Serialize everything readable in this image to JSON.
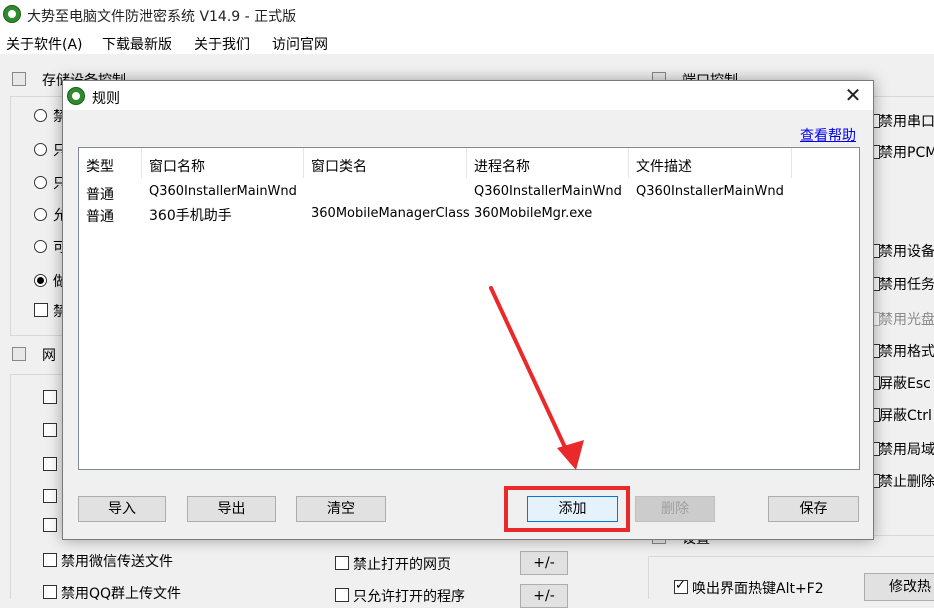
{
  "app": {
    "title": "大势至电脑文件防泄密系统 V14.9 - 正式版",
    "menu": [
      "关于软件(A)",
      "下载最新版",
      "关于我们",
      "访问官网"
    ]
  },
  "background": {
    "storage_group_title": "存储设备控制",
    "storage_options": [
      {
        "label": "禁",
        "type": "radio",
        "checked": false
      },
      {
        "label": "只",
        "type": "radio",
        "checked": false
      },
      {
        "label": "只",
        "type": "radio",
        "checked": false
      },
      {
        "label": "允",
        "type": "radio",
        "checked": false
      },
      {
        "label": "可",
        "type": "radio",
        "checked": false
      },
      {
        "label": "做",
        "type": "radio",
        "checked": true
      },
      {
        "label": "禁",
        "type": "checkbox",
        "checked": false
      }
    ],
    "network_group_title": "网",
    "port_group_title": "端口控制",
    "left_bottom_checks": [
      {
        "label": "禁用微信传送文件",
        "checked": false
      },
      {
        "label": "禁用QQ群上传文件",
        "checked": false
      }
    ],
    "mid_checks": [
      {
        "label": "禁止打开的网页",
        "checked": false
      },
      {
        "label": "只允许打开的程序",
        "checked": false
      }
    ],
    "plus_minus_label": "+/-",
    "right_checks": [
      {
        "label": "禁用串口",
        "checked": false,
        "disabled": false
      },
      {
        "label": "禁用PCM",
        "checked": false,
        "disabled": false
      },
      {
        "label": "禁用设备",
        "checked": false,
        "disabled": false
      },
      {
        "label": "禁用任务",
        "checked": false,
        "disabled": false
      },
      {
        "label": "禁用光盘",
        "checked": false,
        "disabled": true
      },
      {
        "label": "禁用格式",
        "checked": false,
        "disabled": false
      },
      {
        "label": "屏蔽Esc",
        "checked": false,
        "disabled": false
      },
      {
        "label": "屏蔽Ctrl",
        "checked": false,
        "disabled": false
      },
      {
        "label": "禁用局域",
        "checked": false,
        "disabled": false
      },
      {
        "label": "禁止删除",
        "checked": false,
        "disabled": false
      }
    ],
    "settings_group_title": "设置",
    "hotkey_check": {
      "label": "唤出界面热键Alt+F2",
      "checked": true
    },
    "modify_hotkey_label": "修改热"
  },
  "dialog": {
    "title": "规则",
    "help_link": "查看帮助",
    "columns": [
      "类型",
      "窗口名称",
      "窗口类名",
      "进程名称",
      "文件描述"
    ],
    "rows": [
      [
        "普通",
        "Q360InstallerMainWnd",
        "",
        "Q360InstallerMainWnd",
        "Q360InstallerMainWnd"
      ],
      [
        "普通",
        "360手机助手",
        "360MobileManagerClass",
        "360MobileMgr.exe",
        ""
      ]
    ],
    "buttons": {
      "import": "导入",
      "export": "导出",
      "clear": "清空",
      "add": "添加",
      "delete": "删除",
      "save": "保存"
    }
  },
  "annotation": {
    "color": "#ea2a2a"
  }
}
